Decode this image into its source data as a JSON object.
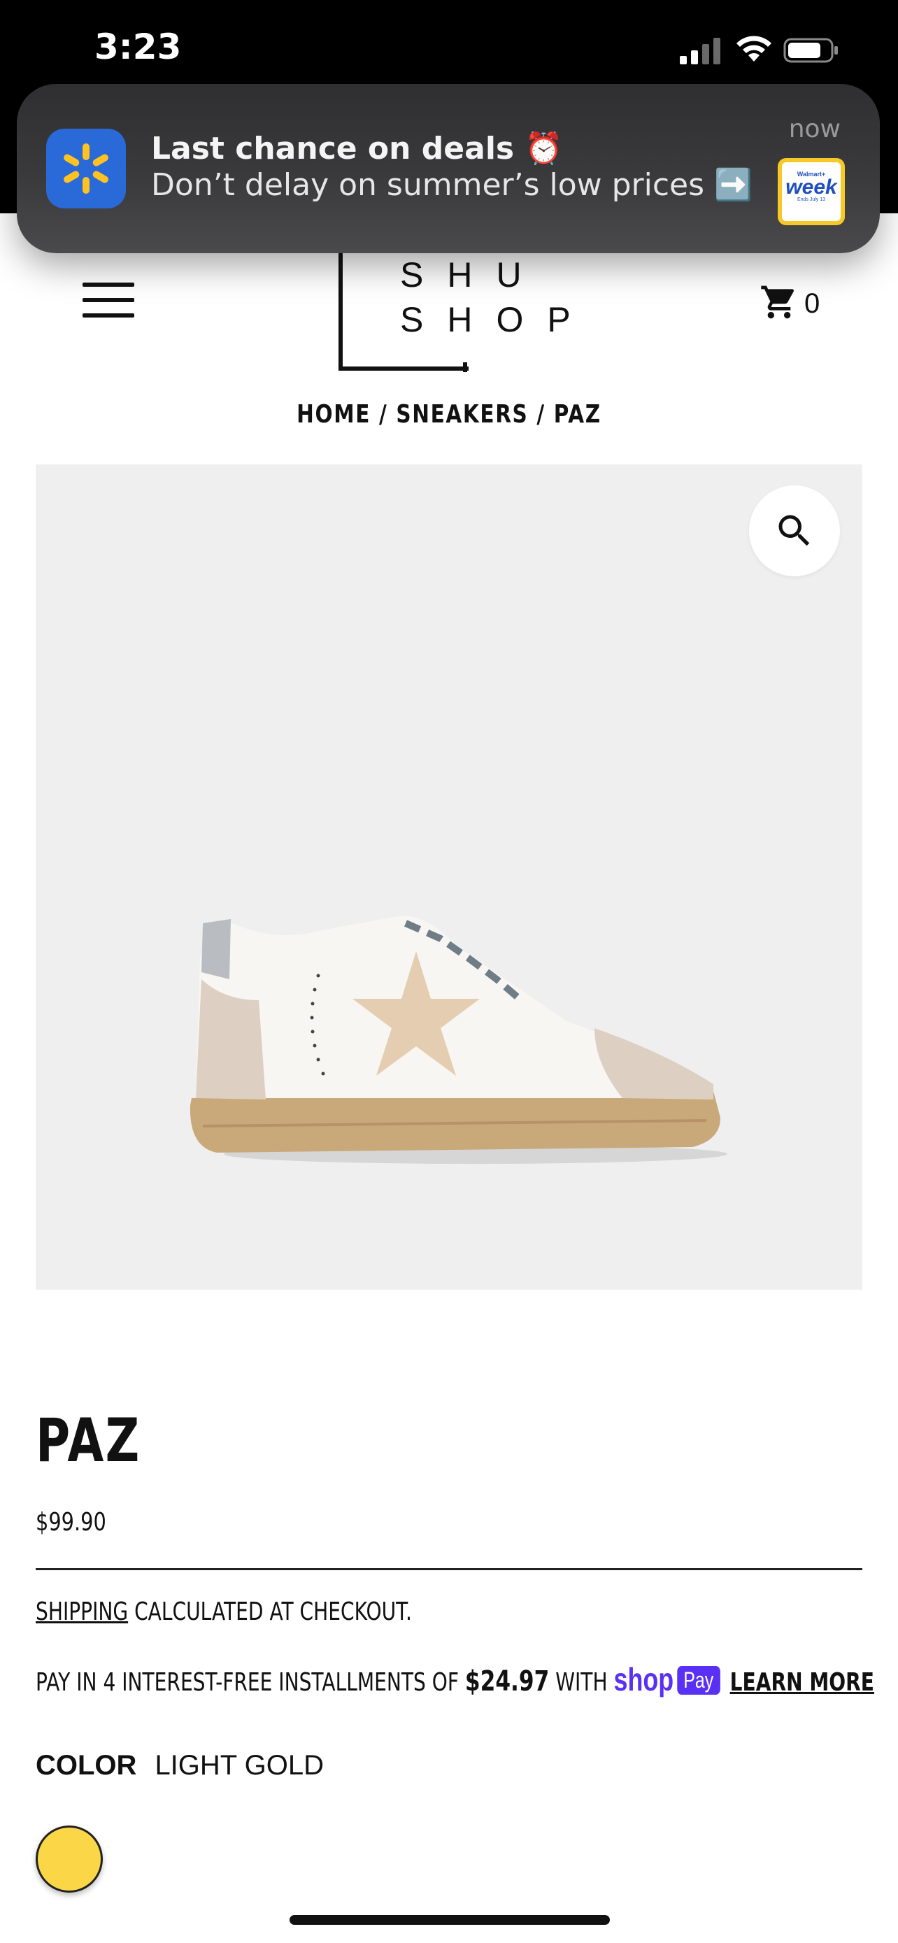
{
  "status_bar": {
    "time": "3:23"
  },
  "notification": {
    "title": "Last chance on deals ⏰",
    "body": "Don’t delay on summer’s low prices ➡️",
    "time": "now",
    "thumb": {
      "line1": "Walmart+",
      "line2": "week",
      "line3": "Ends July 13"
    }
  },
  "header": {
    "logo_line1": "SHU",
    "logo_line2": "SHOP",
    "cart_count": "0"
  },
  "breadcrumb": "HOME / SNEAKERS / PAZ",
  "product": {
    "title": "PAZ",
    "price": "$99.90",
    "shipping_link": "SHIPPING",
    "shipping_rest": " CALCULATED AT CHECKOUT.",
    "installments_prefix": "PAY IN 4 INTEREST-FREE INSTALLMENTS OF ",
    "installments_amount": "$24.97",
    "installments_with": " WITH ",
    "shop_word": "shop",
    "pay_badge": "Pay",
    "learn_more": "LEARN MORE",
    "color_label": "COLOR",
    "color_value": "LIGHT GOLD",
    "swatch_color": "#fbd647"
  },
  "colors": {
    "shop_pay": "#5a31f4",
    "image_bg": "#efefef"
  }
}
